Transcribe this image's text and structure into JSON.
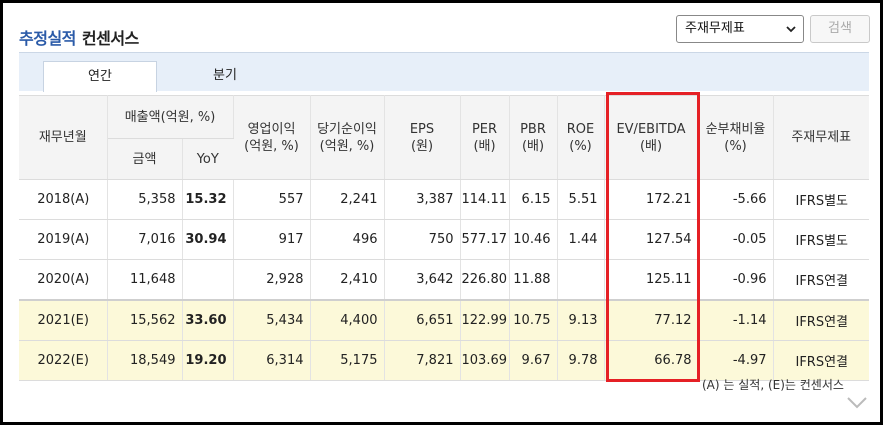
{
  "header": {
    "title_main": "추정실적",
    "title_sub": "컨센서스",
    "select_value": "주재무제표",
    "search_label": "검색"
  },
  "tabs": [
    {
      "label": "연간",
      "active": true
    },
    {
      "label": "분기",
      "active": false
    }
  ],
  "table": {
    "headers": {
      "fiscal_year": "재무년월",
      "sales_group": "매출액(억원, %)",
      "sales_amount": "금액",
      "sales_yoy": "YoY",
      "op_income": "영업이익\n(억원, %)",
      "net_income": "당기순이익\n(억원, %)",
      "eps": "EPS\n(원)",
      "per": "PER\n(배)",
      "pbr": "PBR\n(배)",
      "roe": "ROE\n(%)",
      "ev_ebitda": "EV/EBITDA\n(배)",
      "debt_ratio": "순부채비율\n(%)",
      "statement": "주재무제표"
    },
    "rows": [
      {
        "year": "2018(A)",
        "sales": "5,358",
        "yoy": "15.32",
        "op": "557",
        "net": "2,241",
        "eps": "3,387",
        "per": "114.11",
        "pbr": "6.15",
        "roe": "5.51",
        "ev": "172.21",
        "debt": "-5.66",
        "acct": "IFRS별도",
        "estimate": false
      },
      {
        "year": "2019(A)",
        "sales": "7,016",
        "yoy": "30.94",
        "op": "917",
        "net": "496",
        "eps": "750",
        "per": "577.17",
        "pbr": "10.46",
        "roe": "1.44",
        "ev": "127.54",
        "debt": "-0.05",
        "acct": "IFRS별도",
        "estimate": false
      },
      {
        "year": "2020(A)",
        "sales": "11,648",
        "yoy": "",
        "op": "2,928",
        "net": "2,410",
        "eps": "3,642",
        "per": "226.80",
        "pbr": "11.88",
        "roe": "",
        "ev": "125.11",
        "debt": "-0.96",
        "acct": "IFRS연결",
        "estimate": false
      },
      {
        "year": "2021(E)",
        "sales": "15,562",
        "yoy": "33.60",
        "op": "5,434",
        "net": "4,400",
        "eps": "6,651",
        "per": "122.99",
        "pbr": "10.75",
        "roe": "9.13",
        "ev": "77.12",
        "debt": "-1.14",
        "acct": "IFRS연결",
        "estimate": true
      },
      {
        "year": "2022(E)",
        "sales": "18,549",
        "yoy": "19.20",
        "op": "6,314",
        "net": "5,175",
        "eps": "7,821",
        "per": "103.69",
        "pbr": "9.67",
        "roe": "9.78",
        "ev": "66.78",
        "debt": "-4.97",
        "acct": "IFRS연결",
        "estimate": true
      }
    ]
  },
  "footnote": "(A) 는 실적, (E)는 컨센서스",
  "colors": {
    "title_accent": "#2a5aa8",
    "estimate_row_bg": "#fcf9d9",
    "negative_text": "#c8282d",
    "highlight_box": "#e52025"
  }
}
